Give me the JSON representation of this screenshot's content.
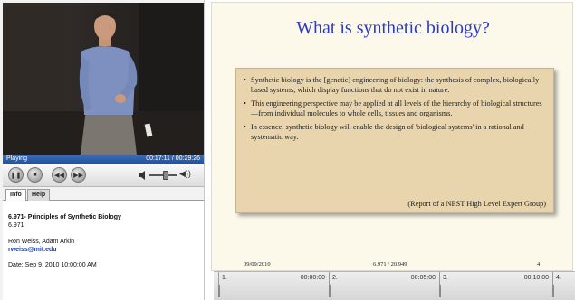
{
  "player": {
    "status": "Playing",
    "time_display": "00:17:11 / 00:29:26",
    "progress_fraction": 0.584
  },
  "tabs": [
    {
      "label": "Info",
      "active": true
    },
    {
      "label": "Help",
      "active": false
    }
  ],
  "info": {
    "course_title": "6.971- Principles of Synthetic Biology",
    "course_number": "6.971",
    "instructors": "Ron Weiss, Adam Arkin",
    "email": "rweiss@mit.edu",
    "date": "Date: Sep 9, 2010 10:00:00 AM"
  },
  "slide": {
    "title": "What is synthetic biology?",
    "bullets": [
      "Synthetic biology is the [genetic] engineering of biology: the synthesis of complex, biologically based systems, which display functions that do not exist in nature.",
      "This engineering perspective may be applied at all levels of the hierarchy of biological structures—from individual molecules to whole cells, tissues and organisms.",
      "In essence, synthetic biology will enable the design of 'biological systems' in a rational and systematic way."
    ],
    "attribution": "(Report of a NEST High Level Expert Group)",
    "footer_date": "09/09/2010",
    "footer_course": "6.971 / 20.949",
    "footer_page": "4"
  },
  "chapters": [
    {
      "num": "1.",
      "time": "00:00:00"
    },
    {
      "num": "2.",
      "time": "00:05:00"
    },
    {
      "num": "3.",
      "time": "00:10:00"
    },
    {
      "num": "4.",
      "time": ""
    }
  ],
  "colors": {
    "status_bar": "#2d5ca8",
    "slide_title": "#2b3bc4",
    "bullet_box": "#e8d5ad",
    "email_link": "#1a3fa8"
  }
}
